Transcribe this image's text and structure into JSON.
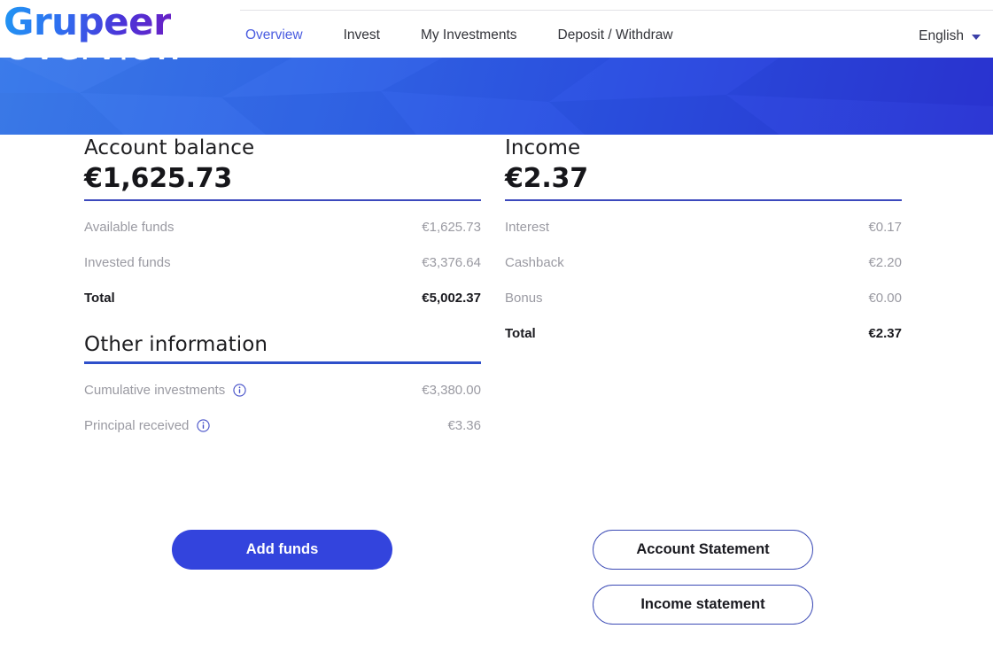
{
  "brand": {
    "name": "Grupeer"
  },
  "nav": {
    "items": [
      {
        "label": "Overview",
        "active": true
      },
      {
        "label": "Invest",
        "active": false
      },
      {
        "label": "My Investments",
        "active": false
      },
      {
        "label": "Deposit / Withdraw",
        "active": false
      }
    ],
    "language": {
      "label": "English",
      "icon": "chevron-down-icon"
    }
  },
  "banner": {
    "title": "Overview"
  },
  "account_balance": {
    "title": "Account balance",
    "amount": "€1,625.73",
    "rows": [
      {
        "label": "Available funds",
        "value": "€1,625.73"
      },
      {
        "label": "Invested funds",
        "value": "€3,376.64"
      }
    ],
    "total": {
      "label": "Total",
      "value": "€5,002.37"
    }
  },
  "other_information": {
    "title": "Other information",
    "rows": [
      {
        "label": "Cumulative investments",
        "value": "€3,380.00",
        "icon": "info-icon"
      },
      {
        "label": "Principal received",
        "value": "€3.36",
        "icon": "info-icon"
      }
    ]
  },
  "income": {
    "title": "Income",
    "amount": "€2.37",
    "rows": [
      {
        "label": "Interest",
        "value": "€0.17"
      },
      {
        "label": "Cashback",
        "value": "€2.20"
      },
      {
        "label": "Bonus",
        "value": "€0.00"
      }
    ],
    "total": {
      "label": "Total",
      "value": "€2.37"
    }
  },
  "actions": {
    "add_funds": "Add funds",
    "account_statement": "Account Statement",
    "income_statement": "Income statement"
  },
  "colors": {
    "accent_blue": "#3344dd",
    "nav_active": "#4a5ce0",
    "muted_text": "#9a9aa2",
    "banner_from": "#3b7bea",
    "banner_to": "#2a34d4"
  }
}
